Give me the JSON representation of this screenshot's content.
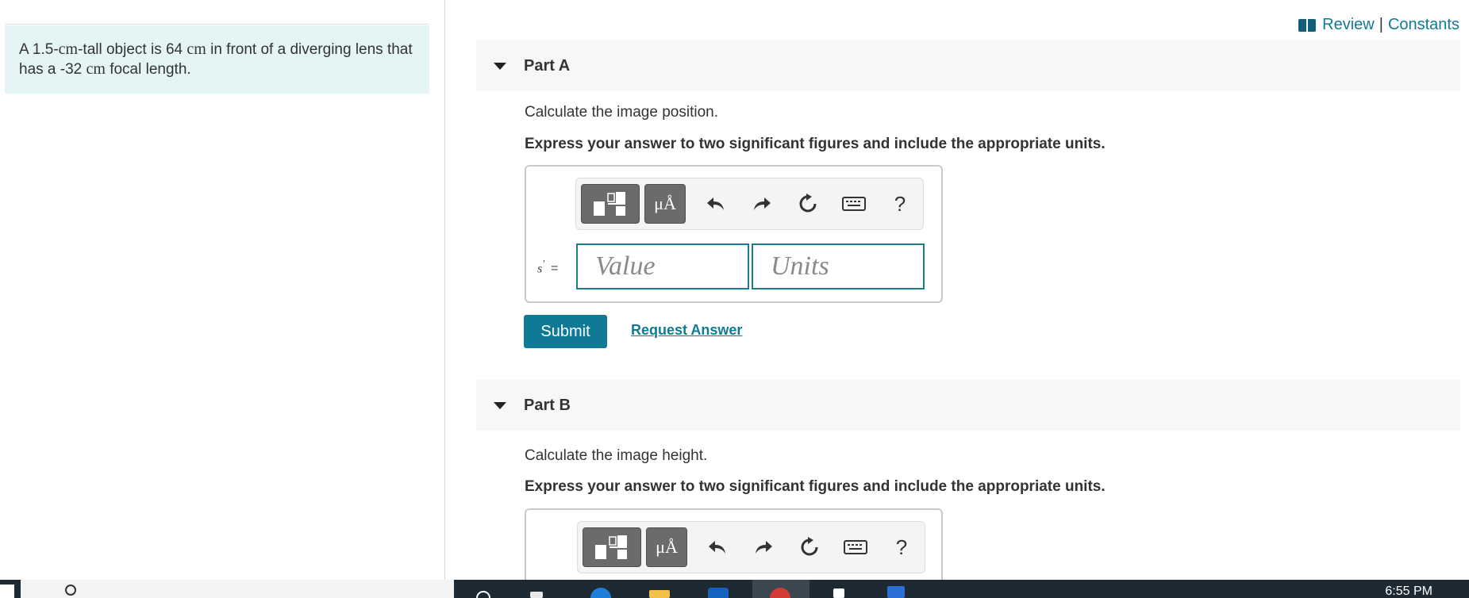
{
  "problem": {
    "prefix": "A 1.5-",
    "unit1": "cm",
    "middle1": "-tall object is 64 ",
    "unit2": "cm",
    "middle2": " in front of a diverging lens that has a -32 ",
    "unit3": "cm",
    "suffix": " focal length."
  },
  "top_links": {
    "review": "Review",
    "separator": "|",
    "constants": "Constants"
  },
  "part_a": {
    "title": "Part A",
    "instruction": "Calculate the image position.",
    "instruction_bold": "Express your answer to two significant figures and include the appropriate units.",
    "units_button": "μÅ",
    "help": "?",
    "variable": "s",
    "prime": "′",
    "equals": "=",
    "value_placeholder": "Value",
    "units_placeholder": "Units",
    "submit": "Submit",
    "request_answer": "Request Answer"
  },
  "part_b": {
    "title": "Part B",
    "instruction": "Calculate the image height.",
    "instruction_bold": "Express your answer to two significant figures and include the appropriate units.",
    "units_button": "μÅ",
    "help": "?"
  },
  "taskbar": {
    "clock": "6:55 PM"
  },
  "colors": {
    "accent": "#0f7a96",
    "problem_bg": "#e5f5f5",
    "header_bg": "#f7f7f7"
  }
}
